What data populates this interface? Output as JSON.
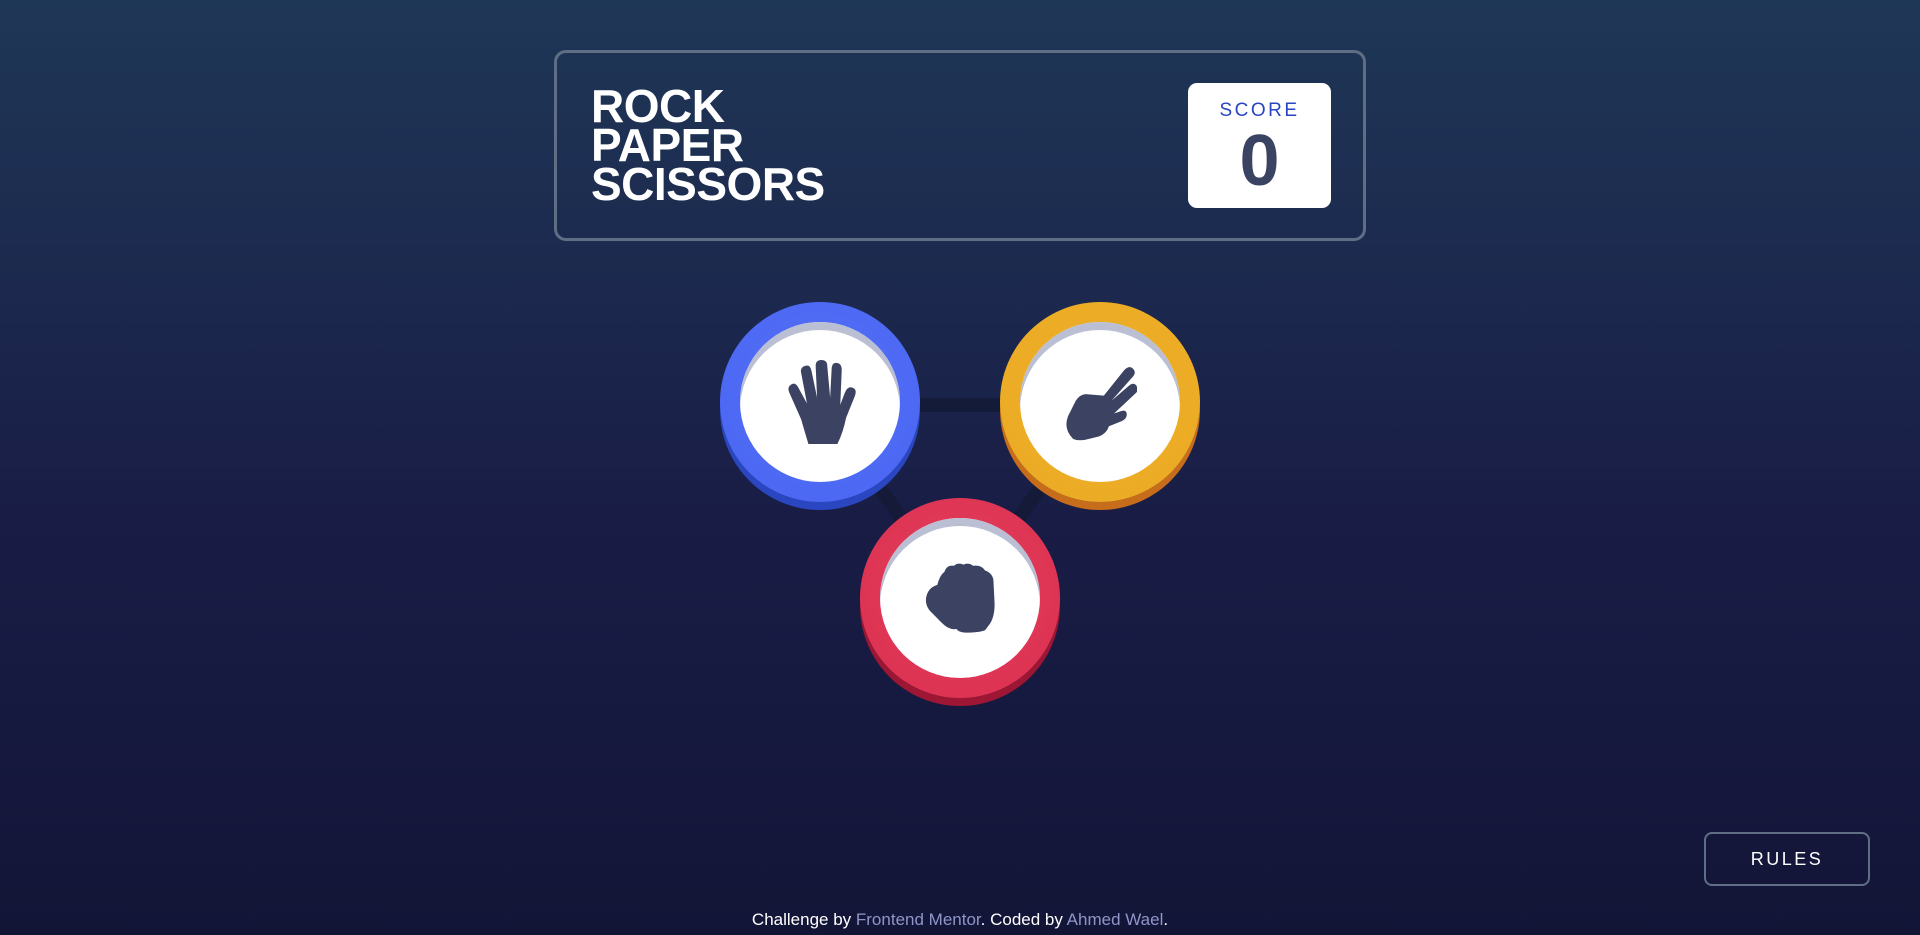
{
  "header": {
    "title_lines": [
      "ROCK",
      "PAPER",
      "SCISSORS"
    ],
    "score_label": "SCORE",
    "score_value": "0"
  },
  "board": {
    "tokens": [
      {
        "id": "paper",
        "icon": "hand-paper-icon",
        "ring_color": "#4865f4"
      },
      {
        "id": "scissors",
        "icon": "hand-scissors-icon",
        "ring_color": "#eca922"
      },
      {
        "id": "rock",
        "icon": "hand-rock-icon",
        "ring_color": "#dc2e4e"
      }
    ]
  },
  "rules_button": {
    "label": "RULES"
  },
  "footer": {
    "prefix": "Challenge by ",
    "link1": "Frontend Mentor",
    "middle": ". Coded by ",
    "link2": "Ahmed Wael",
    "suffix": "."
  },
  "colors": {
    "background_top": "#1f3757",
    "background_bottom": "#131537",
    "header_outline": "#606e85",
    "score_label": "#2a45c2",
    "score_value": "#3b4363"
  }
}
